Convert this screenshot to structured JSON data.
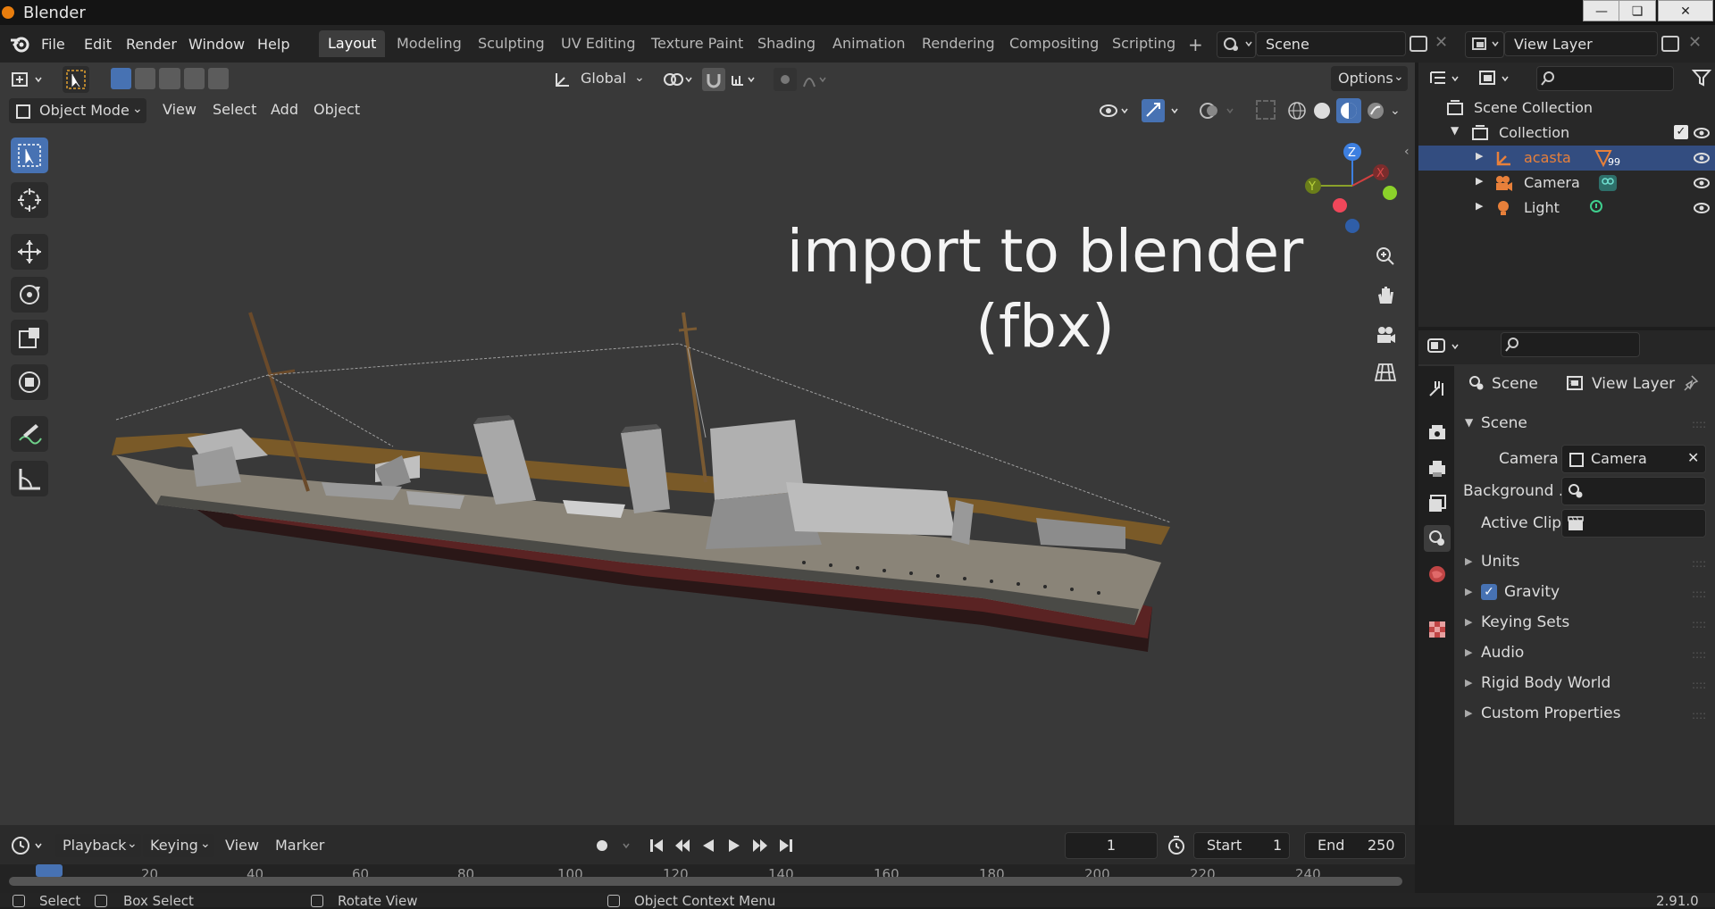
{
  "window": {
    "title": "Blender"
  },
  "menu": {
    "file": "File",
    "edit": "Edit",
    "render": "Render",
    "window": "Window",
    "help": "Help"
  },
  "workspaces": [
    {
      "label": "Layout",
      "active": true
    },
    {
      "label": "Modeling"
    },
    {
      "label": "Sculpting"
    },
    {
      "label": "UV Editing"
    },
    {
      "label": "Texture Paint"
    },
    {
      "label": "Shading"
    },
    {
      "label": "Animation"
    },
    {
      "label": "Rendering"
    },
    {
      "label": "Compositing"
    },
    {
      "label": "Scripting"
    }
  ],
  "scene_selector": {
    "value": "Scene"
  },
  "view_layer_selector": {
    "value": "View Layer"
  },
  "viewport": {
    "transform_orientation": "Global",
    "options_label": "Options",
    "mode": "Object Mode",
    "menu_view": "View",
    "menu_select": "Select",
    "menu_add": "Add",
    "menu_object": "Object",
    "overlay_line1": "import to blender",
    "overlay_line2": "(fbx)"
  },
  "outliner": {
    "root": "Scene Collection",
    "collection": "Collection",
    "items": [
      {
        "label": "acasta",
        "badge": "99",
        "selected": true
      },
      {
        "label": "Camera"
      },
      {
        "label": "Light"
      }
    ]
  },
  "properties": {
    "breadcrumb_scene": "Scene",
    "breadcrumb_view_layer": "View Layer",
    "panel_title": "Scene",
    "camera_label": "Camera",
    "camera_value": "Camera",
    "background_label": "Background ...",
    "active_clip_label": "Active Clip",
    "sections": [
      {
        "label": "Units"
      },
      {
        "label": "Gravity",
        "checked": true
      },
      {
        "label": "Keying Sets"
      },
      {
        "label": "Audio"
      },
      {
        "label": "Rigid Body World"
      },
      {
        "label": "Custom Properties"
      }
    ]
  },
  "timeline": {
    "playback": "Playback",
    "keying": "Keying",
    "view": "View",
    "marker": "Marker",
    "current_frame": "1",
    "start_label": "Start",
    "start_value": "1",
    "end_label": "End",
    "end_value": "250",
    "ruler_marks": [
      "1",
      "20",
      "40",
      "60",
      "80",
      "100",
      "120",
      "140",
      "160",
      "180",
      "200",
      "220",
      "240"
    ]
  },
  "status": {
    "select": "Select",
    "box_select": "Box Select",
    "rotate_view": "Rotate View",
    "context_menu": "Object Context Menu",
    "version": "2.91.0"
  },
  "colors": {
    "accent": "#4772b3",
    "selected_text": "#e8803a",
    "viewport_bg": "#393939"
  }
}
